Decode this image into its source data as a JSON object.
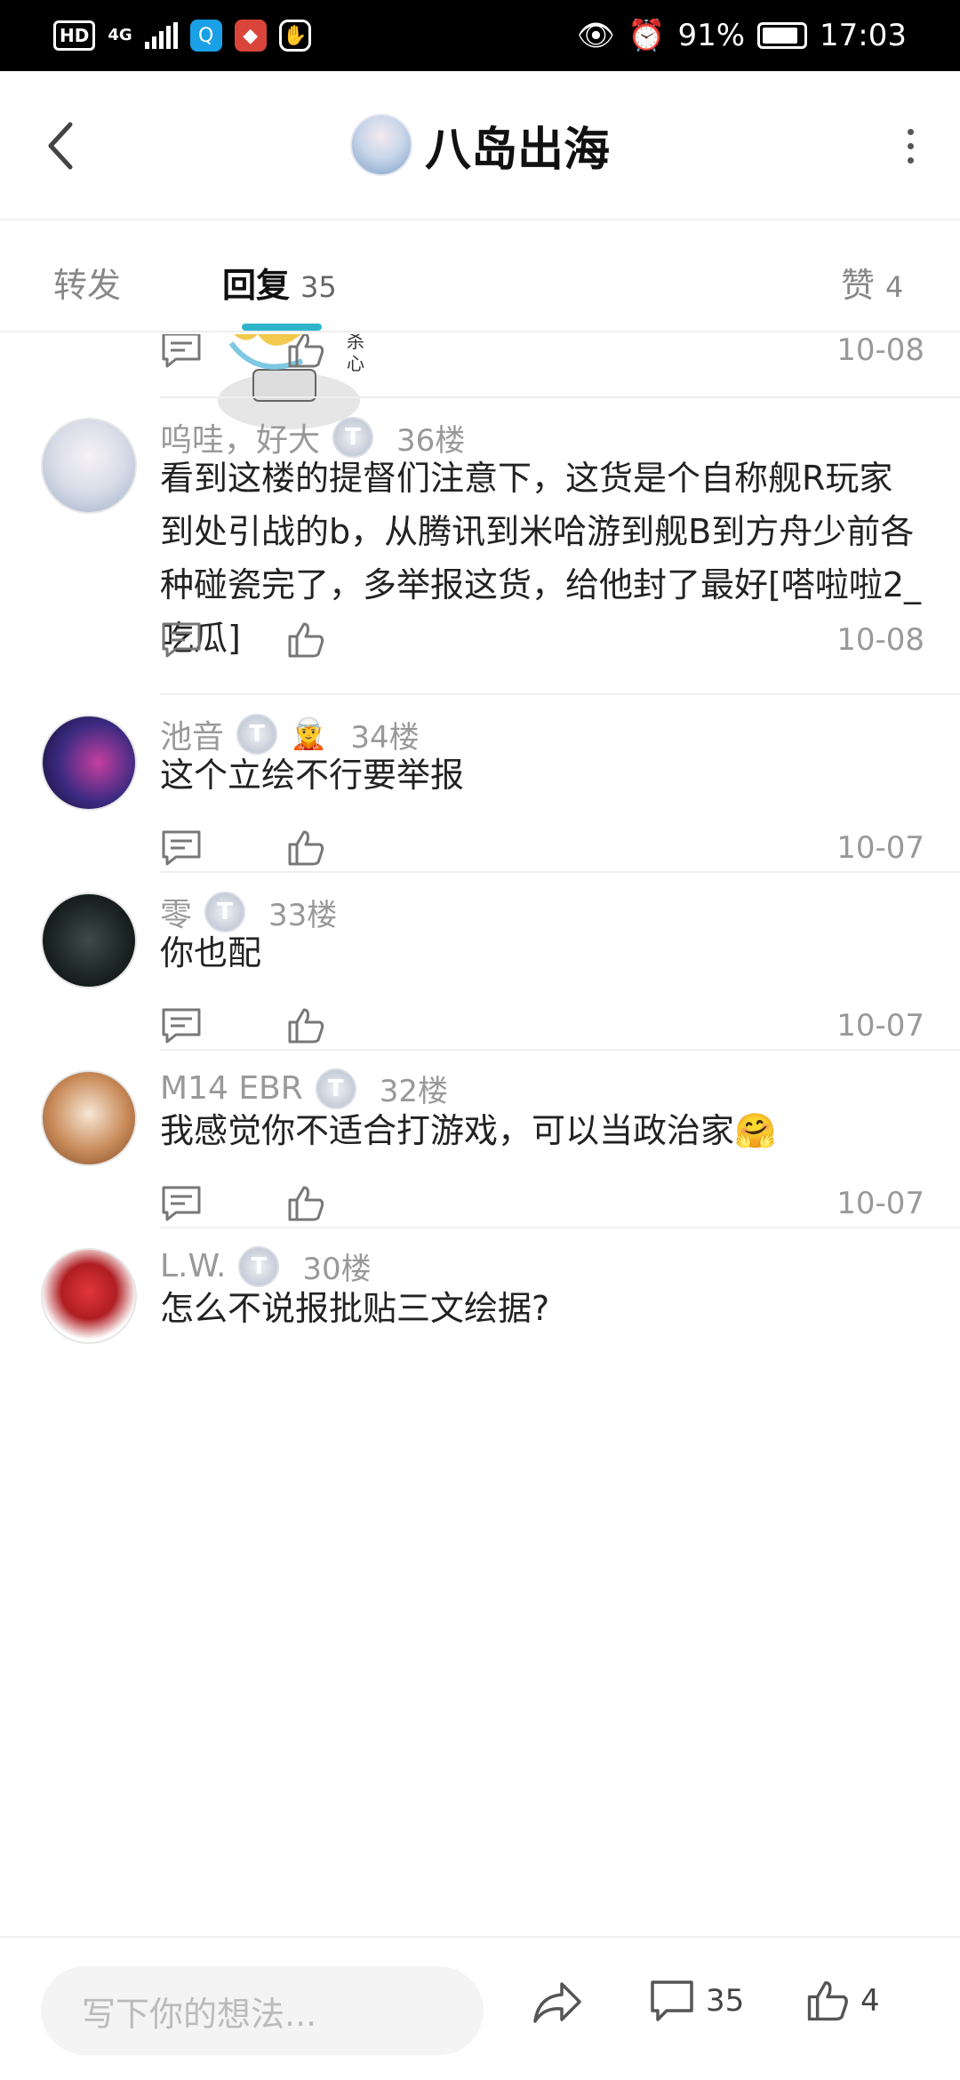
{
  "status_bar": {
    "battery": "91%",
    "time": "17:03",
    "network": "4G"
  },
  "header": {
    "title": "八岛出海"
  },
  "tabs": [
    {
      "label": "转发",
      "count": ""
    },
    {
      "label": "回复",
      "count": "35"
    },
    {
      "label": "赞",
      "count": "4"
    }
  ],
  "first": {
    "date": "10-08"
  },
  "comments": [
    {
      "user": "呜哇，好大",
      "floor": "36楼",
      "text": "看到这楼的提督们注意下，这货是个自称舰R玩家到处引战的b，从腾讯到米哈游到舰B到方舟少前各种碰瓷完了，多举报这货，给他封了最好[嗒啦啦2_吃瓜]",
      "date": "10-08"
    },
    {
      "user": "池音",
      "floor": "34楼",
      "text": "这个立绘不行要举报",
      "date": "10-07"
    },
    {
      "user": "零",
      "floor": "33楼",
      "text": "你也配",
      "date": "10-07"
    },
    {
      "user": "M14 EBR",
      "floor": "32楼",
      "text": "我感觉你不适合打游戏，可以当政治家🤗",
      "date": "10-07"
    },
    {
      "user": "L.W.",
      "floor": "30楼",
      "text": "怎么不说报批贴三文绘据?",
      "date": ""
    }
  ],
  "bottom": {
    "placeholder": "写下你的想法...",
    "comment_count": "35",
    "like_count": "4"
  },
  "colors": {
    "accent": "#2fb5c9"
  }
}
